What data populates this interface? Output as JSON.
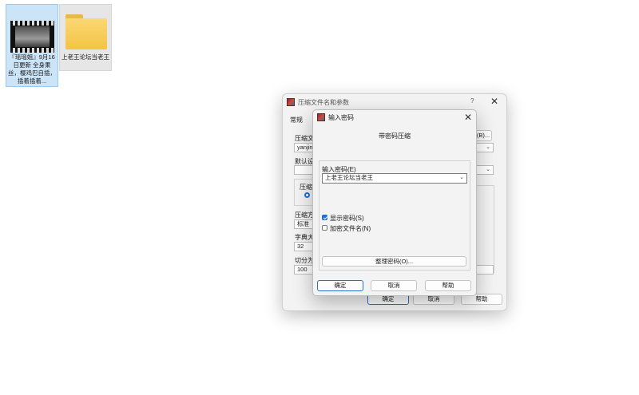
{
  "desktop": {
    "video_file": {
      "label": "『瑶瑶姐』9月16日更新 全身果丝，樱鸡巴自插，插着插着..."
    },
    "folder": {
      "label": "上老王论坛当老王"
    }
  },
  "archive_dialog": {
    "title": "压缩文件名和参数",
    "help_glyph": "?",
    "close_glyph": "✕",
    "tab_general": "常规",
    "archive_name_label": "压缩文",
    "archive_name_value": "yanjin",
    "browse_label": "(B)...",
    "default_settings_label": "默认设",
    "format_label": "压缩",
    "method_label": "压缩方",
    "method_value": "标准",
    "dict_label": "字典大",
    "dict_value": "32",
    "split_label": "切分为",
    "split_value": "100",
    "ok_label": "确定",
    "cancel_label": "取消",
    "help_label": "帮助"
  },
  "password_dialog": {
    "title": "输入密码",
    "close_glyph": "✕",
    "heading": "带密码压缩",
    "password_label": "输入密码(E)",
    "password_value": "上老王论坛当老王",
    "show_password_label": "显示密码(S)",
    "show_password_checked": true,
    "encrypt_names_label": "加密文件名(N)",
    "encrypt_names_checked": false,
    "organize_button": "整理密码(O)...",
    "ok_label": "确定",
    "cancel_label": "取消",
    "help_label": "帮助"
  },
  "colors": {
    "accent": "#1e6fd9",
    "selection": "#cce4f7"
  }
}
